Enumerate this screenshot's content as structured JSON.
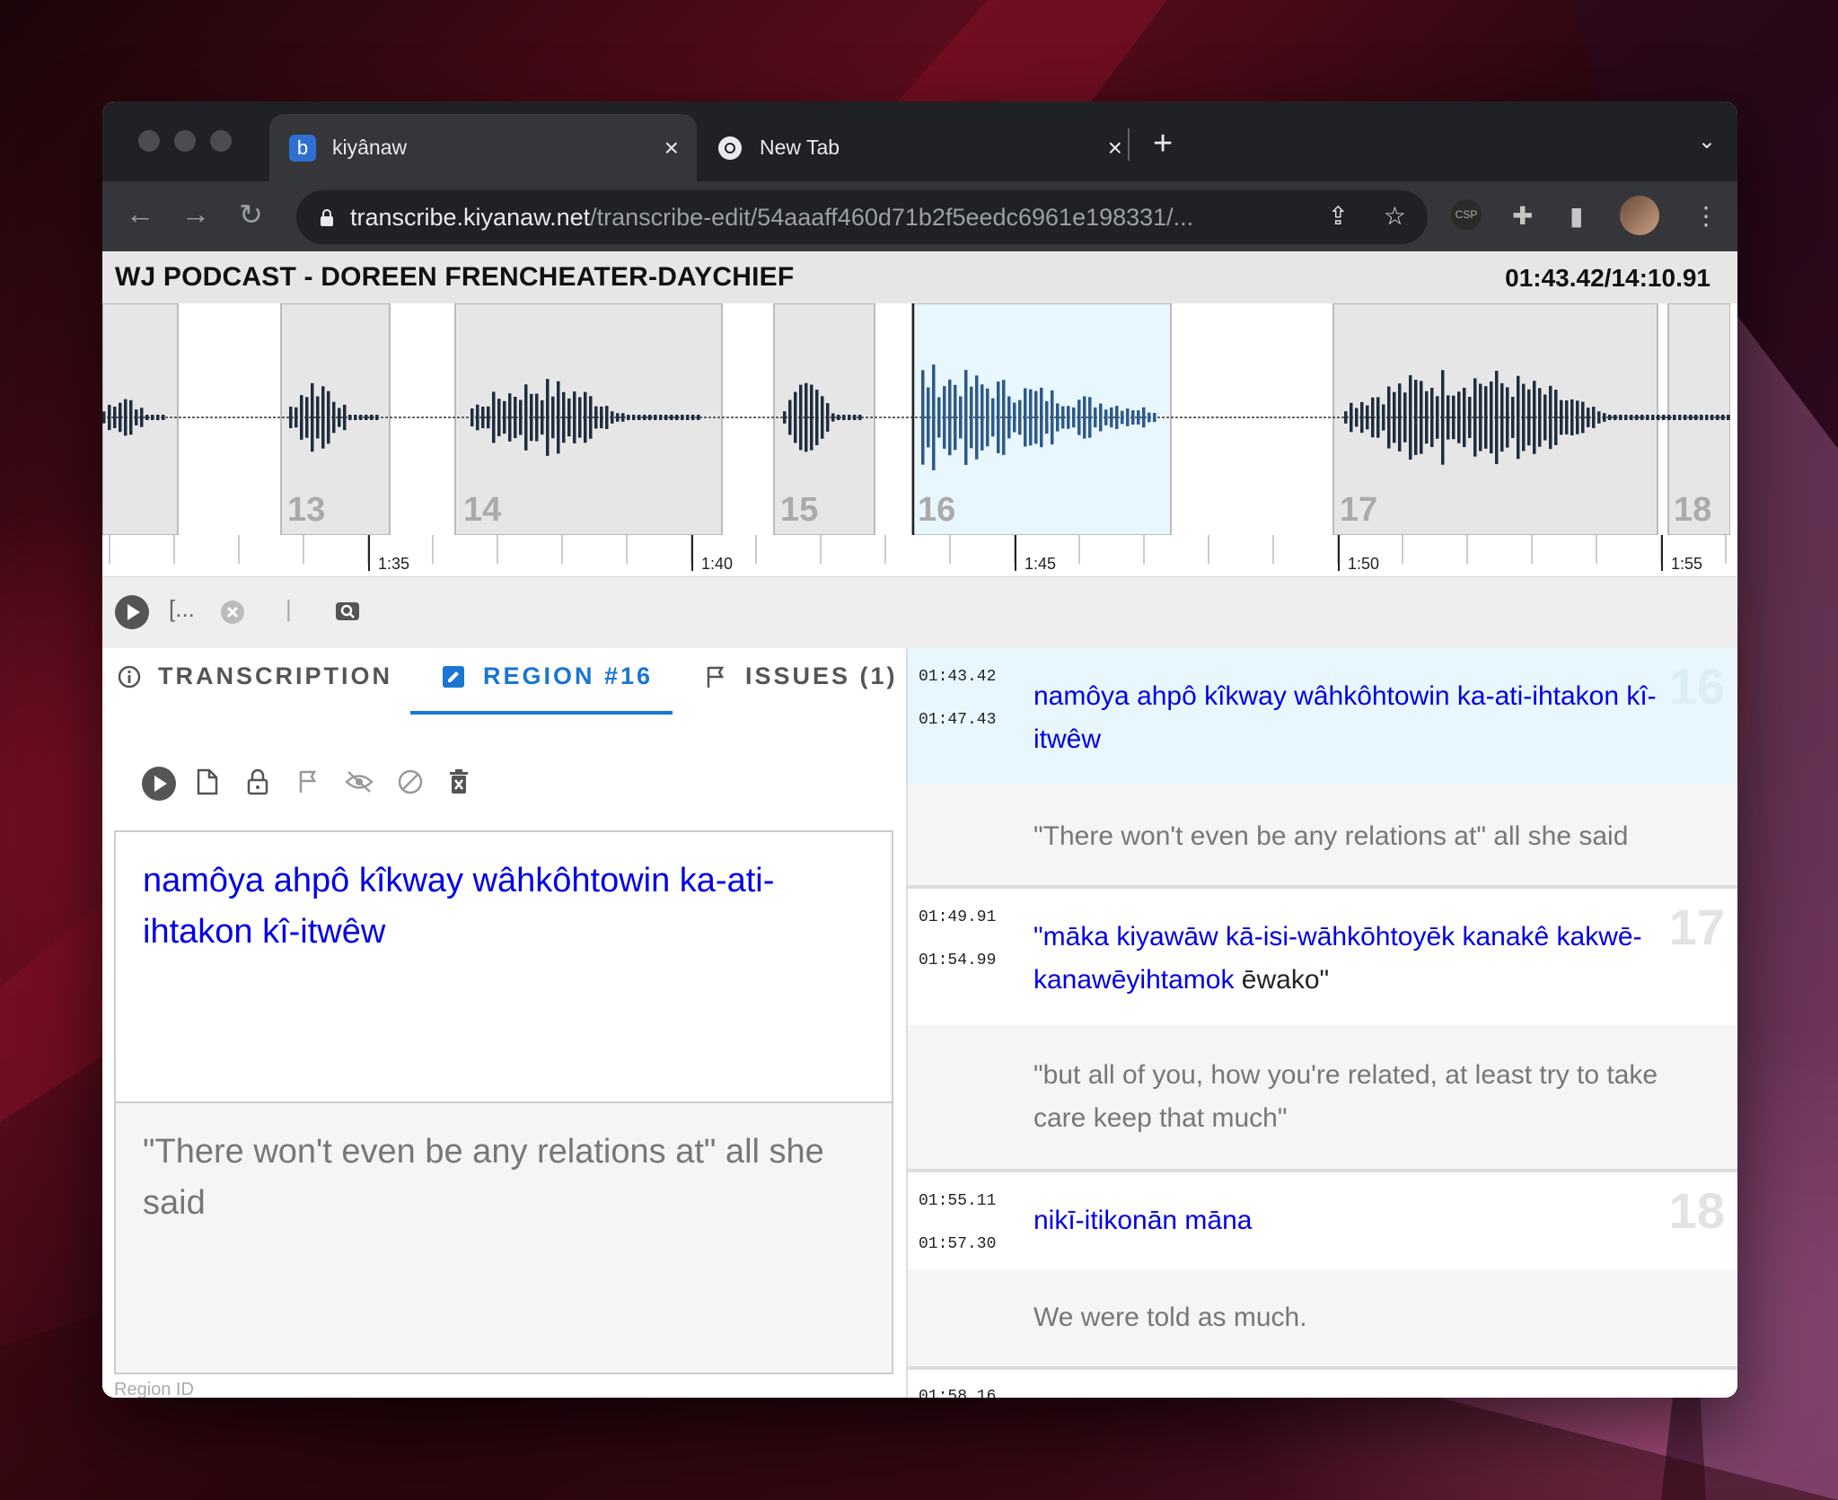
{
  "browser": {
    "tabs": [
      {
        "title": "kiyânaw",
        "favicon": "b"
      },
      {
        "title": "New Tab",
        "favicon": "chrome-icon"
      }
    ],
    "url_host": "transcribe.kiyanaw.net",
    "url_path": "/transcribe-edit/54aaaff460d71b2f5eedc6961e198331/...",
    "extension_label": "CSP"
  },
  "app": {
    "title": "WJ PODCAST - DOREEN FRENCHEATER-DAYCHIEF",
    "timecode": "01:43.42/14:10.91",
    "colors": {
      "accent": "#1976d2",
      "wave": "#1f2d40",
      "wave_selected": "#2d5a8a",
      "region_selected": "#e8f7fd",
      "region": "#e6e6e6"
    }
  },
  "waveform": {
    "regions": [
      {
        "label": "13"
      },
      {
        "label": "14"
      },
      {
        "label": "15"
      },
      {
        "label": "16",
        "selected": true
      },
      {
        "label": "17"
      },
      {
        "label": "18"
      }
    ],
    "time_labels": [
      "1:35",
      "1:40",
      "1:45",
      "1:50",
      "1:55"
    ]
  },
  "controls": {
    "play": "play-icon",
    "bracket": "[...",
    "divider": "|"
  },
  "left_panel": {
    "tabs": [
      {
        "label": "TRANSCRIPTION",
        "icon": "info-icon"
      },
      {
        "label": "REGION #16",
        "icon": "edit-icon"
      },
      {
        "label": "ISSUES (1)",
        "icon": "flag-icon"
      }
    ],
    "region_text": "namôya ahpô kîkway wâhkôhtowin ka-ati-ihtakon kî-itwêw",
    "translation": "\"There won't even be any relations at\" all she said",
    "region_id_label": "Region ID"
  },
  "segments": [
    {
      "number": "16",
      "start": "01:43.42",
      "end": "01:47.43",
      "text": "namôya ahpô kîkway wâhkôhtowin ka-ati-ihtakon kî-itwêw",
      "text_black": "",
      "translation": "\"There won't even be any relations at\" all she said"
    },
    {
      "number": "17",
      "start": "01:49.91",
      "end": "01:54.99",
      "text": "\"māka kiyawāw kā-isi-wāhkōhtoyēk kanakê kakwē-kanawēyihtamok",
      "text_black": " ēwako\"",
      "translation": "\"but all of you, how you're related, at least try to take care keep that much\""
    },
    {
      "number": "18",
      "start": "01:55.11",
      "end": "01:57.30",
      "text": "nikī-itikonān māna",
      "text_black": "",
      "translation": "We were told as much."
    },
    {
      "start": "01:58.16"
    }
  ]
}
